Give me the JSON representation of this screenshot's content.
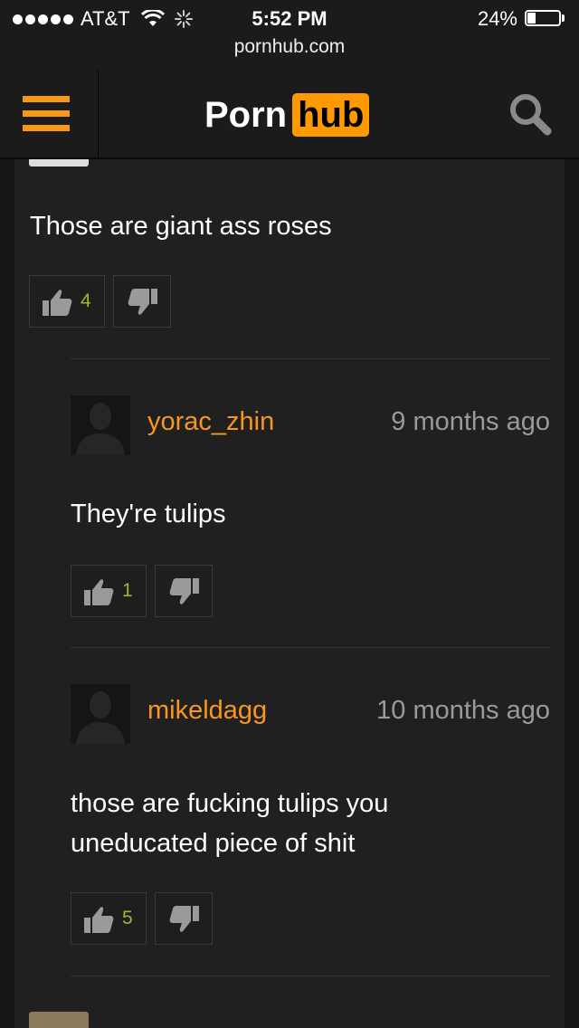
{
  "status_bar": {
    "carrier": "AT&T",
    "time": "5:52 PM",
    "battery": "24%",
    "url": "pornhub.com"
  },
  "header": {
    "logo_part1": "Porn",
    "logo_part2": "hub"
  },
  "comments": [
    {
      "text": "Those are giant ass roses",
      "likes": "4"
    },
    {
      "username": "yorac_zhin",
      "time": "9 months ago",
      "text": "They're tulips",
      "likes": "1"
    },
    {
      "username": "mikeldagg",
      "time": "10 months ago",
      "text_line1": "those are fucking tulips you",
      "text_line2": "uneducated piece of shit",
      "likes": "5"
    }
  ],
  "colors": {
    "accent": "#f7971d",
    "like_count": "#a8b32a",
    "background": "#202020"
  }
}
